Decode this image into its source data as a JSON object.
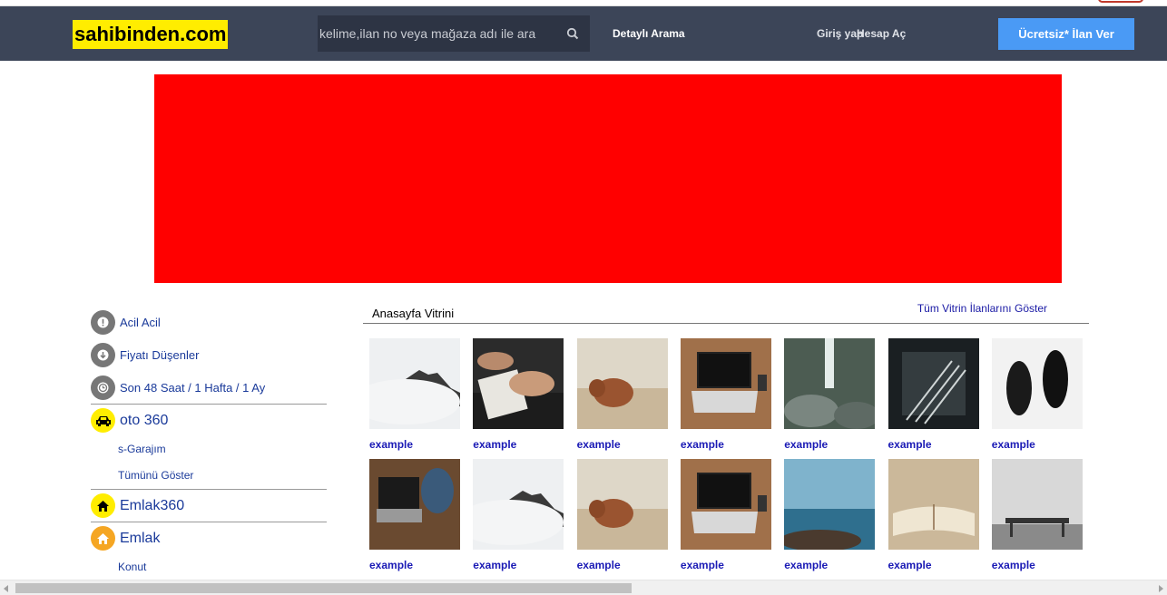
{
  "header": {
    "logo_text": "sahibinden.com",
    "search_placeholder": "kelime,ilan no veya mağaza adı ile ara",
    "detailed_search": "Detaylı Arama",
    "login": "Giriş yap",
    "register": "Hesap Aç",
    "post_ad_button": "Ücretsiz* İlan Ver"
  },
  "colors": {
    "header_bg": "#3c4558",
    "logo_bg": "#ffed00",
    "banner": "#ff0000",
    "cta": "#4a9af5",
    "link": "#1a3a9a"
  },
  "sidebar": {
    "quick_links": [
      {
        "label": "Acil Acil",
        "icon": "exclamation-icon"
      },
      {
        "label": "Fiyatı Düşenler",
        "icon": "arrow-down-icon"
      },
      {
        "label": "Son 48 Saat / 1 Hafta / 1 Ay",
        "icon": "clock-icon"
      }
    ],
    "categories": [
      {
        "label": "oto 360",
        "icon": "car-icon",
        "subs": [
          "s-Garajım",
          "Tümünü Göster"
        ]
      },
      {
        "label": "Emlak360",
        "icon": "home-icon",
        "subs": []
      },
      {
        "label": "Emlak",
        "icon": "home-icon",
        "subs": [
          "Konut"
        ]
      }
    ]
  },
  "showcase": {
    "title": "Anasayfa Vitrini",
    "show_all": "Tüm Vitrin İlanlarını Göster",
    "items": [
      {
        "caption": "example",
        "image": "misty-mountain"
      },
      {
        "caption": "example",
        "image": "hands-notebook"
      },
      {
        "caption": "example",
        "image": "highland-cow"
      },
      {
        "caption": "example",
        "image": "laptop-desk"
      },
      {
        "caption": "example",
        "image": "waterfall"
      },
      {
        "caption": "example",
        "image": "forks-dark"
      },
      {
        "caption": "example",
        "image": "feet-bw"
      },
      {
        "caption": "example",
        "image": "person-laptop"
      },
      {
        "caption": "example",
        "image": "misty-mountain"
      },
      {
        "caption": "example",
        "image": "highland-cow"
      },
      {
        "caption": "example",
        "image": "laptop-desk"
      },
      {
        "caption": "example",
        "image": "sea-coast"
      },
      {
        "caption": "example",
        "image": "open-book"
      },
      {
        "caption": "example",
        "image": "bench-wall"
      }
    ]
  }
}
